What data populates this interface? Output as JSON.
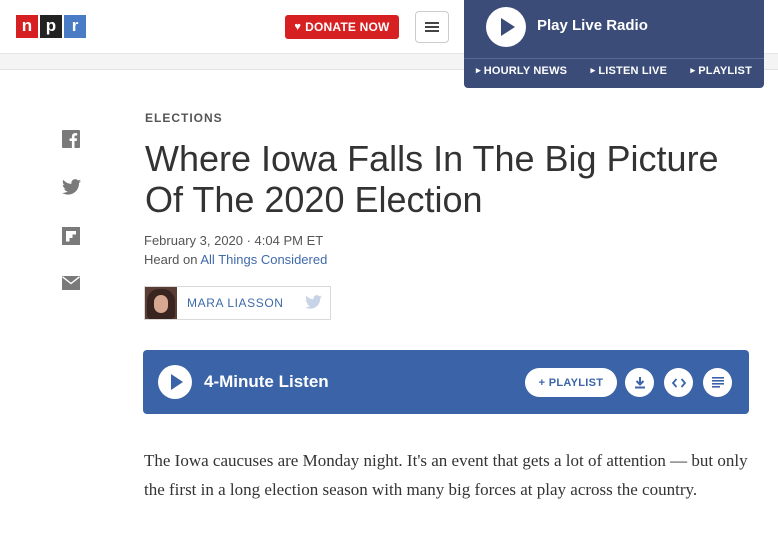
{
  "header": {
    "logo": [
      "n",
      "p",
      "r"
    ],
    "donate_label": "DONATE NOW",
    "live": {
      "title": "Play Live Radio",
      "links": [
        "HOURLY NEWS",
        "LISTEN LIVE",
        "PLAYLIST"
      ]
    }
  },
  "share": {
    "icons": [
      "facebook-icon",
      "twitter-icon",
      "flipboard-icon",
      "email-icon"
    ]
  },
  "article": {
    "slug": "ELECTIONS",
    "title": "Where Iowa Falls In The Big Picture Of The 2020 Election",
    "dateline": "February 3, 2020 · 4:04 PM ET",
    "heard_prefix": "Heard on ",
    "heard_show": "All Things Considered",
    "byline_name": "MARA LIASSON",
    "audio": {
      "title": "4-Minute Listen",
      "playlist_label": "+ PLAYLIST"
    },
    "body": "The Iowa caucuses are Monday night. It's an event that gets a lot of attention — but only the first in a long election season with many big forces at play across the country."
  },
  "colors": {
    "npr_red": "#d62021",
    "npr_blue": "#4a7bc5",
    "live_panel": "#3b4c78",
    "player_blue": "#3b64a8",
    "link": "#3f6aa9"
  }
}
